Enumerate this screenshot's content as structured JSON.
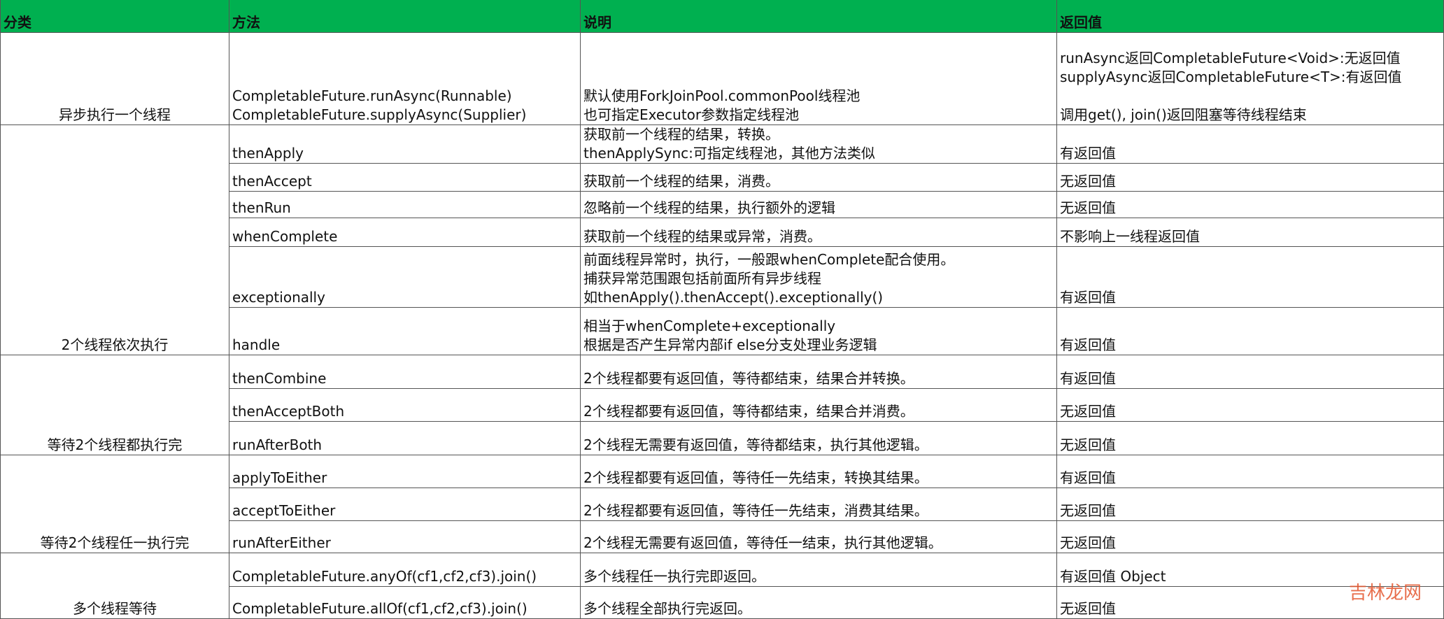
{
  "header": {
    "category": "分类",
    "method": "方法",
    "description": "说明",
    "return_value": "返回值"
  },
  "groups": [
    {
      "category": "异步执行一个线程",
      "rows": [
        {
          "method": [
            "CompletableFuture.runAsync(Runnable)",
            "CompletableFuture.supplyAsync(Supplier)"
          ],
          "description": [
            "默认使用ForkJoinPool.commonPool线程池",
            "也可指定Executor参数指定线程池"
          ],
          "return_value": [
            "runAsync返回CompletableFuture<Void>:无返回值",
            "supplyAsync返回CompletableFuture<T>:有返回值",
            "调用get(), join()返回阻塞等待线程结束"
          ]
        }
      ]
    },
    {
      "category": "2个线程依次执行",
      "rows": [
        {
          "method": [
            "thenApply"
          ],
          "description": [
            "获取前一个线程的结果，转换。",
            "thenApplySync:可指定线程池，其他方法类似"
          ],
          "return_value": [
            "有返回值"
          ]
        },
        {
          "method": [
            "thenAccept"
          ],
          "description": [
            "获取前一个线程的结果，消费。"
          ],
          "return_value": [
            "无返回值"
          ]
        },
        {
          "method": [
            "thenRun"
          ],
          "description": [
            "忽略前一个线程的结果，执行额外的逻辑"
          ],
          "return_value": [
            "无返回值"
          ]
        },
        {
          "method": [
            "whenComplete"
          ],
          "description": [
            "获取前一个线程的结果或异常，消费。"
          ],
          "return_value": [
            "不影响上一线程返回值"
          ]
        },
        {
          "method": [
            "exceptionally"
          ],
          "description": [
            "前面线程异常时，执行，一般跟whenComplete配合使用。",
            "捕获异常范围跟包括前面所有异步线程",
            "如thenApply().thenAccept().exceptionally()"
          ],
          "return_value": [
            "有返回值"
          ]
        },
        {
          "method": [
            "handle"
          ],
          "description": [
            "相当于whenComplete+exceptionally",
            "根据是否产生异常内部if else分支处理业务逻辑"
          ],
          "return_value": [
            "有返回值"
          ]
        }
      ]
    },
    {
      "category": "等待2个线程都执行完",
      "rows": [
        {
          "method": [
            "thenCombine"
          ],
          "description": [
            "2个线程都要有返回值，等待都结束，结果合并转换。"
          ],
          "return_value": [
            "有返回值"
          ]
        },
        {
          "method": [
            "thenAcceptBoth"
          ],
          "description": [
            "2个线程都要有返回值，等待都结束，结果合并消费。"
          ],
          "return_value": [
            "无返回值"
          ]
        },
        {
          "method": [
            "runAfterBoth"
          ],
          "description": [
            "2个线程无需要有返回值，等待都结束，执行其他逻辑。"
          ],
          "return_value": [
            "无返回值"
          ]
        }
      ]
    },
    {
      "category": "等待2个线程任一执行完",
      "rows": [
        {
          "method": [
            "applyToEither"
          ],
          "description": [
            "2个线程都要有返回值，等待任一先结束，转换其结果。"
          ],
          "return_value": [
            "有返回值"
          ]
        },
        {
          "method": [
            "acceptToEither"
          ],
          "description": [
            "2个线程都要有返回值，等待任一先结束，消费其结果。"
          ],
          "return_value": [
            "无返回值"
          ]
        },
        {
          "method": [
            "runAfterEither"
          ],
          "description": [
            "2个线程无需要有返回值，等待任一结束，执行其他逻辑。"
          ],
          "return_value": [
            "无返回值"
          ]
        }
      ]
    },
    {
      "category": "多个线程等待",
      "rows": [
        {
          "method": [
            "CompletableFuture.anyOf(cf1,cf2,cf3).join()"
          ],
          "description": [
            "多个线程任一执行完即返回。"
          ],
          "return_value": [
            "有返回值 Object"
          ]
        },
        {
          "method": [
            "CompletableFuture.allOf(cf1,cf2,cf3).join()"
          ],
          "description": [
            "多个线程全部执行完返回。"
          ],
          "return_value": [
            "无返回值"
          ]
        }
      ]
    }
  ],
  "watermark": "吉林龙网",
  "colors": {
    "header_background": "#00b050",
    "grid_line": "#555555",
    "watermark": "#e4572e"
  }
}
